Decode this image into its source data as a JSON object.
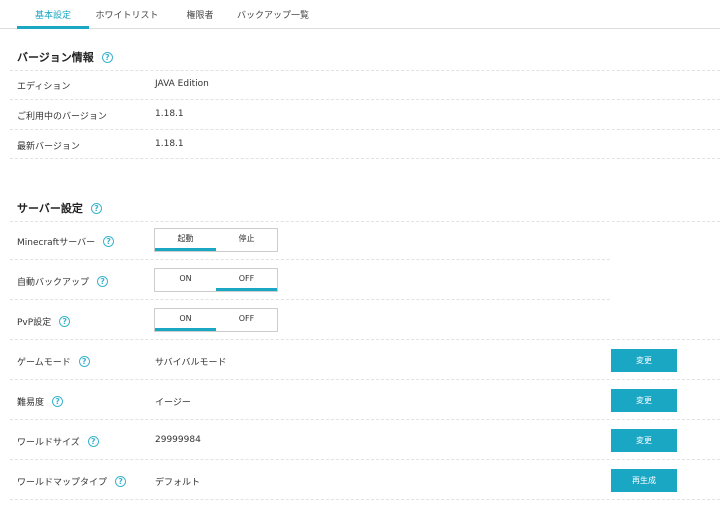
{
  "tabs": [
    {
      "label": "基本設定",
      "active": true
    },
    {
      "label": "ホワイトリスト",
      "active": false
    },
    {
      "label": "権限者",
      "active": false
    },
    {
      "label": "バックアップ一覧",
      "active": false
    }
  ],
  "help_glyph": "?",
  "version_section": {
    "title": "バージョン情報",
    "rows": [
      {
        "label": "エディション",
        "value": "JAVA Edition"
      },
      {
        "label": "ご利用中のバージョン",
        "value": "1.18.1"
      },
      {
        "label": "最新バージョン",
        "value": "1.18.1"
      }
    ]
  },
  "server_section": {
    "title": "サーバー設定",
    "toggles": [
      {
        "label": "Minecraftサーバー",
        "left": "起動",
        "right": "停止",
        "selected": "left"
      },
      {
        "label": "自動バックアップ",
        "left": "ON",
        "right": "OFF",
        "selected": "right"
      },
      {
        "label": "PvP設定",
        "left": "ON",
        "right": "OFF",
        "selected": "left"
      }
    ],
    "settings": [
      {
        "label": "ゲームモード",
        "value": "サバイバルモード",
        "button": "変更"
      },
      {
        "label": "難易度",
        "value": "イージー",
        "button": "変更"
      },
      {
        "label": "ワールドサイズ",
        "value": "29999984",
        "button": "変更"
      },
      {
        "label": "ワールドマップタイプ",
        "value": "デフォルト",
        "button": "再生成"
      }
    ]
  },
  "colors": {
    "accent": "#1aa7c4",
    "help_icon": "#3bb3ce"
  }
}
